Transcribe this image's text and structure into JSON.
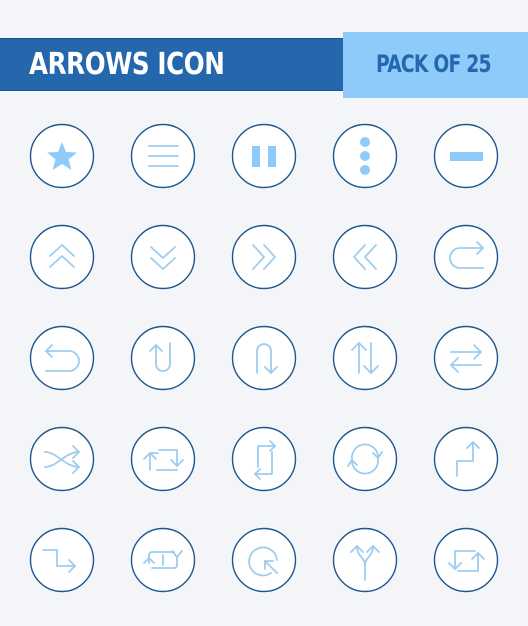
{
  "header": {
    "title": "ARROWS ICON",
    "badge": "PACK OF 25"
  },
  "colors": {
    "background": "#f3f5f9",
    "title_bar": "#2567ad",
    "badge_bg": "#8ecbfb",
    "circle_stroke": "#1f568f",
    "circle_fill": "#ffffff",
    "icon_fill": "#8ecbfb",
    "icon_line": "#9dcdee"
  },
  "icons": [
    {
      "name": "star-icon"
    },
    {
      "name": "menu-icon"
    },
    {
      "name": "pause-icon"
    },
    {
      "name": "more-vertical-icon"
    },
    {
      "name": "minus-icon"
    },
    {
      "name": "double-chevron-up-icon"
    },
    {
      "name": "double-chevron-down-icon"
    },
    {
      "name": "double-chevron-right-icon"
    },
    {
      "name": "double-chevron-left-icon"
    },
    {
      "name": "redo-u-turn-icon"
    },
    {
      "name": "undo-u-turn-icon"
    },
    {
      "name": "u-turn-up-icon"
    },
    {
      "name": "u-turn-down-icon"
    },
    {
      "name": "swap-vertical-icon"
    },
    {
      "name": "swap-horizontal-icon"
    },
    {
      "name": "shuffle-icon"
    },
    {
      "name": "repeat-horizontal-icon"
    },
    {
      "name": "repeat-vertical-icon"
    },
    {
      "name": "refresh-icon"
    },
    {
      "name": "step-up-arrow-icon"
    },
    {
      "name": "step-right-arrow-icon"
    },
    {
      "name": "repeat-one-icon"
    },
    {
      "name": "rotate-arrow-icon"
    },
    {
      "name": "split-arrow-icon"
    },
    {
      "name": "loop-arrow-icon"
    }
  ]
}
